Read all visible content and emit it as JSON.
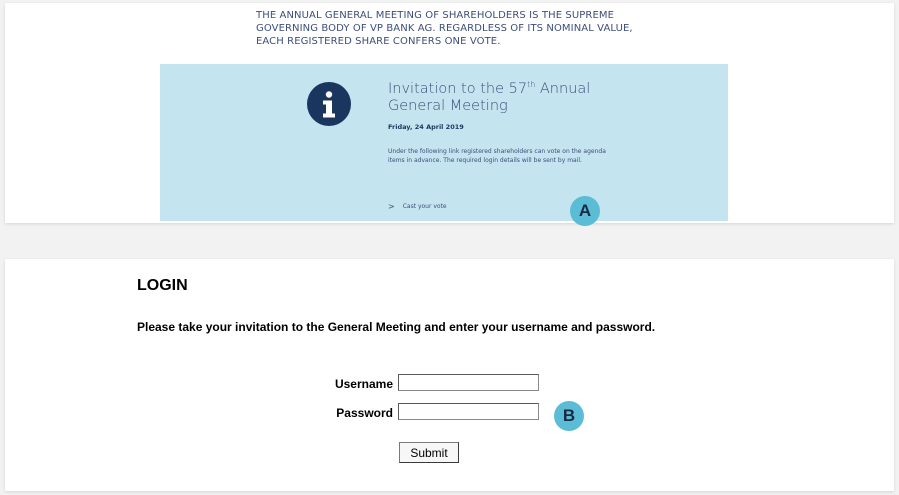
{
  "intro_text": "THE ANNUAL GENERAL MEETING OF SHAREHOLDERS IS THE SUPREME GOVERNING BODY OF VP BANK AG. REGARDLESS OF ITS NOMINAL VALUE, EACH REGISTERED SHARE CONFERS ONE VOTE.",
  "invitation": {
    "title_pre": "Invitation to the 57",
    "title_sup": "th",
    "title_post": " Annual General Meeting",
    "date": "Friday, 24 April 2019",
    "description": "Under the following link registered shareholders can vote on the agenda items in advance. The required login details will be sent by mail.",
    "link_chevron": ">",
    "link_label": "Cast your vote",
    "icon": "info-icon"
  },
  "markers": {
    "a": "A",
    "b": "B"
  },
  "login": {
    "title": "LOGIN",
    "instruction": "Please take your invitation to the General Meeting and enter your username and password.",
    "username_label": "Username",
    "username_value": "",
    "password_label": "Password",
    "password_value": "",
    "submit_label": "Submit"
  },
  "colors": {
    "navy": "#1b365e",
    "text_blue": "#3d4e7a",
    "invite_bg": "#c4e4ef",
    "marker": "#5bbcd6"
  }
}
